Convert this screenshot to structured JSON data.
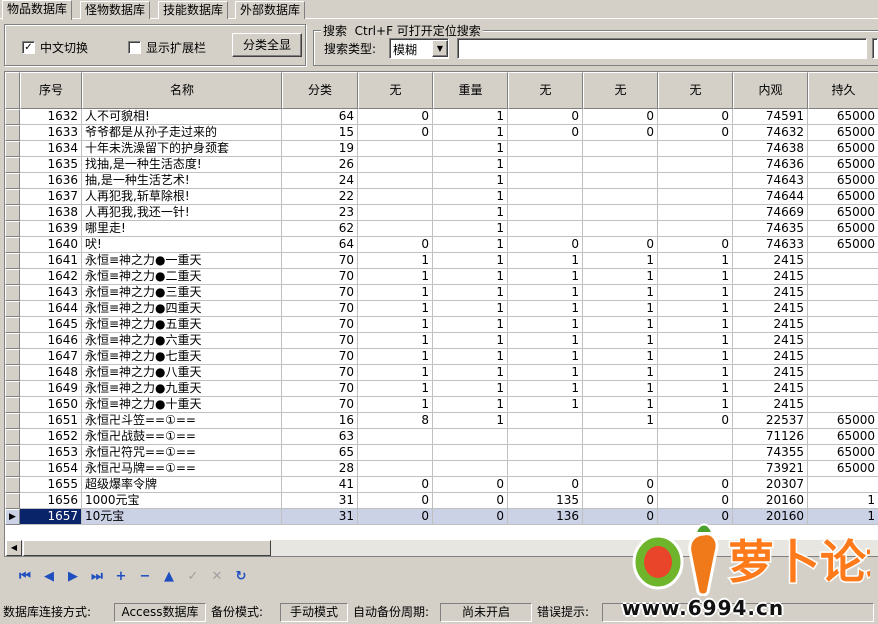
{
  "tabs": [
    {
      "label": "物品数据库",
      "active": true
    },
    {
      "label": "怪物数据库",
      "active": false
    },
    {
      "label": "技能数据库",
      "active": false
    },
    {
      "label": "外部数据库",
      "active": false
    }
  ],
  "filters": {
    "chinese_toggle_label": "中文切换",
    "chinese_toggle_checked": true,
    "show_extended_label": "显示扩展栏",
    "show_extended_checked": false,
    "show_all_button": "分类全显"
  },
  "search": {
    "group_title": "搜索",
    "shortcut_hint": "Ctrl+F 可打开定位搜索",
    "type_label": "搜索类型:",
    "type_value": "模糊",
    "query_value": ""
  },
  "grid": {
    "columns": [
      "序号",
      "名称",
      "分类",
      "无",
      "重量",
      "无",
      "无",
      "无",
      "内观",
      "持久"
    ],
    "rows": [
      [
        "1632",
        "人不可貌相!",
        "64",
        "0",
        "1",
        "0",
        "0",
        "0",
        "74591",
        "65000"
      ],
      [
        "1633",
        "爷爷都是从孙子走过来的",
        "15",
        "0",
        "1",
        "0",
        "0",
        "0",
        "74632",
        "65000"
      ],
      [
        "1634",
        "十年未洗澡留下的护身颈套",
        "19",
        "",
        "1",
        "",
        "",
        "",
        "74638",
        "65000"
      ],
      [
        "1635",
        "找抽,是一种生活态度!",
        "26",
        "",
        "1",
        "",
        "",
        "",
        "74636",
        "65000"
      ],
      [
        "1636",
        "抽,是一种生活艺术!",
        "24",
        "",
        "1",
        "",
        "",
        "",
        "74643",
        "65000"
      ],
      [
        "1637",
        "人再犯我,斩草除根!",
        "22",
        "",
        "1",
        "",
        "",
        "",
        "74644",
        "65000"
      ],
      [
        "1638",
        "人再犯我,我还一针!",
        "23",
        "",
        "1",
        "",
        "",
        "",
        "74669",
        "65000"
      ],
      [
        "1639",
        "哪里走!",
        "62",
        "",
        "1",
        "",
        "",
        "",
        "74635",
        "65000"
      ],
      [
        "1640",
        "吠!",
        "64",
        "0",
        "1",
        "0",
        "0",
        "0",
        "74633",
        "65000"
      ],
      [
        "1641",
        "永恒≡神之力●一重天",
        "70",
        "1",
        "1",
        "1",
        "1",
        "1",
        "2415",
        ""
      ],
      [
        "1642",
        "永恒≡神之力●二重天",
        "70",
        "1",
        "1",
        "1",
        "1",
        "1",
        "2415",
        ""
      ],
      [
        "1643",
        "永恒≡神之力●三重天",
        "70",
        "1",
        "1",
        "1",
        "1",
        "1",
        "2415",
        ""
      ],
      [
        "1644",
        "永恒≡神之力●四重天",
        "70",
        "1",
        "1",
        "1",
        "1",
        "1",
        "2415",
        ""
      ],
      [
        "1645",
        "永恒≡神之力●五重天",
        "70",
        "1",
        "1",
        "1",
        "1",
        "1",
        "2415",
        ""
      ],
      [
        "1646",
        "永恒≡神之力●六重天",
        "70",
        "1",
        "1",
        "1",
        "1",
        "1",
        "2415",
        ""
      ],
      [
        "1647",
        "永恒≡神之力●七重天",
        "70",
        "1",
        "1",
        "1",
        "1",
        "1",
        "2415",
        ""
      ],
      [
        "1648",
        "永恒≡神之力●八重天",
        "70",
        "1",
        "1",
        "1",
        "1",
        "1",
        "2415",
        ""
      ],
      [
        "1649",
        "永恒≡神之力●九重天",
        "70",
        "1",
        "1",
        "1",
        "1",
        "1",
        "2415",
        ""
      ],
      [
        "1650",
        "永恒≡神之力●十重天",
        "70",
        "1",
        "1",
        "1",
        "1",
        "1",
        "2415",
        ""
      ],
      [
        "1651",
        "永恒卍斗笠==①==",
        "16",
        "8",
        "1",
        "",
        "1",
        "0",
        "22537",
        "65000"
      ],
      [
        "1652",
        "永恒卍战鼓==①==",
        "63",
        "",
        "",
        "",
        "",
        "",
        "71126",
        "65000"
      ],
      [
        "1653",
        "永恒卍符咒==①==",
        "65",
        "",
        "",
        "",
        "",
        "",
        "74355",
        "65000"
      ],
      [
        "1654",
        "永恒卍马牌==①==",
        "28",
        "",
        "",
        "",
        "",
        "",
        "73921",
        "65000"
      ],
      [
        "1655",
        "超级爆率令牌",
        "41",
        "0",
        "0",
        "0",
        "0",
        "0",
        "20307",
        ""
      ],
      [
        "1656",
        "1000元宝",
        "31",
        "0",
        "0",
        "135",
        "0",
        "0",
        "20160",
        "1"
      ],
      [
        "1657",
        "10元宝",
        "31",
        "0",
        "0",
        "136",
        "0",
        "0",
        "20160",
        "1"
      ]
    ],
    "selected_row_index": 25,
    "row_indicator": "▶"
  },
  "navigator": {
    "buttons": [
      {
        "name": "first-record",
        "glyph": "⏮",
        "enabled": true
      },
      {
        "name": "prior-record",
        "glyph": "◀",
        "enabled": true
      },
      {
        "name": "next-record",
        "glyph": "▶",
        "enabled": true
      },
      {
        "name": "last-record",
        "glyph": "⏭",
        "enabled": true
      },
      {
        "name": "insert-record",
        "glyph": "+",
        "enabled": true
      },
      {
        "name": "delete-record",
        "glyph": "−",
        "enabled": true
      },
      {
        "name": "edit-record",
        "glyph": "▲",
        "enabled": true
      },
      {
        "name": "post-record",
        "glyph": "✓",
        "enabled": false
      },
      {
        "name": "cancel-edit",
        "glyph": "✕",
        "enabled": false
      },
      {
        "name": "refresh-data",
        "glyph": "↻",
        "enabled": true
      }
    ]
  },
  "status": {
    "db_connection_label": "数据库连接方式:",
    "db_connection_value": "Access数据库",
    "backup_mode_label": "备份模式:",
    "backup_mode_value": "手动模式",
    "auto_backup_label": "自动备份周期:",
    "auto_backup_value": "尚未开启",
    "error_label": "错误提示:",
    "error_value": ""
  },
  "watermark": {
    "text": "萝卜论坛",
    "url": "www.6994.cn"
  },
  "colors": {
    "window_bg": "#d4d0c8",
    "selection_bg": "#0a246a",
    "selected_row_bg": "#ccd2e6",
    "navigator_icon": "#1f4fbf"
  }
}
